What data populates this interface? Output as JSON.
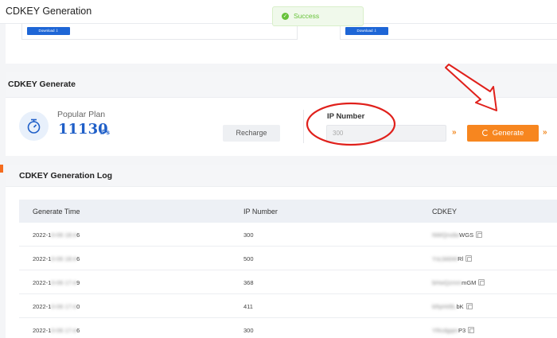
{
  "app": {
    "title": "CDKEY Generation"
  },
  "toast": {
    "text": "Success"
  },
  "downloads": [
    {
      "label": "Download"
    },
    {
      "label": "Download"
    }
  ],
  "generate": {
    "title": "CDKEY Generate",
    "plan_label": "Popular Plan",
    "plan_value": "11130",
    "plan_unit": "IPs",
    "recharge_label": "Recharge",
    "ip_label": "IP Number",
    "ip_placeholder": "300",
    "chevron": "»",
    "generate_label": "Generate"
  },
  "log": {
    "title": "CDKEY Generation Log",
    "columns": [
      "Generate Time",
      "IP Number",
      "CDKEY"
    ],
    "rows": [
      {
        "time_prefix": "2022-1",
        "time_blur": "0-06 18:4",
        "time_suffix": "6",
        "ip": "300",
        "key_blur": "NWQrxdw",
        "key_suffix": "WGS"
      },
      {
        "time_prefix": "2022-1",
        "time_blur": "0-06 18:4",
        "time_suffix": "6",
        "ip": "500",
        "key_blur": "YsLbkbW",
        "key_suffix": "Rl"
      },
      {
        "time_prefix": "2022-1",
        "time_blur": "0-06 17:4",
        "time_suffix": "9",
        "ip": "368",
        "key_blur": "bHwQzmm",
        "key_suffix": "mGM"
      },
      {
        "time_prefix": "2022-1",
        "time_blur": "0-06 17:4",
        "time_suffix": "0",
        "ip": "411",
        "key_blur": "kRpHrBL",
        "key_suffix": "bK"
      },
      {
        "time_prefix": "2022-1",
        "time_blur": "0-06 17:4",
        "time_suffix": "6",
        "ip": "300",
        "key_blur": "YRcdgqm",
        "key_suffix": "P3"
      }
    ]
  },
  "colors": {
    "accent_blue": "#1f5fc8",
    "accent_orange": "#f7861f",
    "success_green": "#67c23a",
    "annotation_red": "#e0201b"
  },
  "icons": {
    "toast": "check-circle-icon",
    "plan": "stopwatch-icon",
    "copy": "copy-icon",
    "generate": "refresh-icon"
  }
}
